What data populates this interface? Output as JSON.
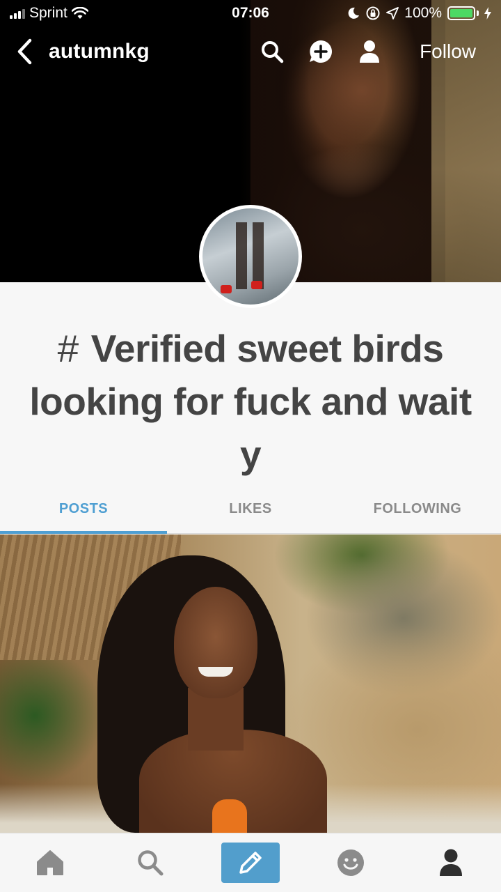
{
  "status_bar": {
    "carrier": "Sprint",
    "time": "07:06",
    "battery": "100%"
  },
  "nav": {
    "blog_name": "autumnkg",
    "follow_label": "Follow",
    "icons": [
      "back-icon",
      "search-icon",
      "add-comment-icon",
      "user-icon"
    ]
  },
  "profile": {
    "title_hash": "#",
    "title": "Verified sweet birds looking for fuck and wait y"
  },
  "tabs": [
    {
      "label": "POSTS",
      "active": true
    },
    {
      "label": "LIKES",
      "active": false
    },
    {
      "label": "FOLLOWING",
      "active": false
    }
  ],
  "tab_bar": {
    "items": [
      "home-icon",
      "search-icon",
      "compose-icon",
      "activity-icon",
      "account-icon"
    ]
  },
  "colors": {
    "accent": "#4f9fd2",
    "compose_bg": "#529ecc",
    "battery_green": "#4cd964",
    "title_text": "#444444"
  }
}
